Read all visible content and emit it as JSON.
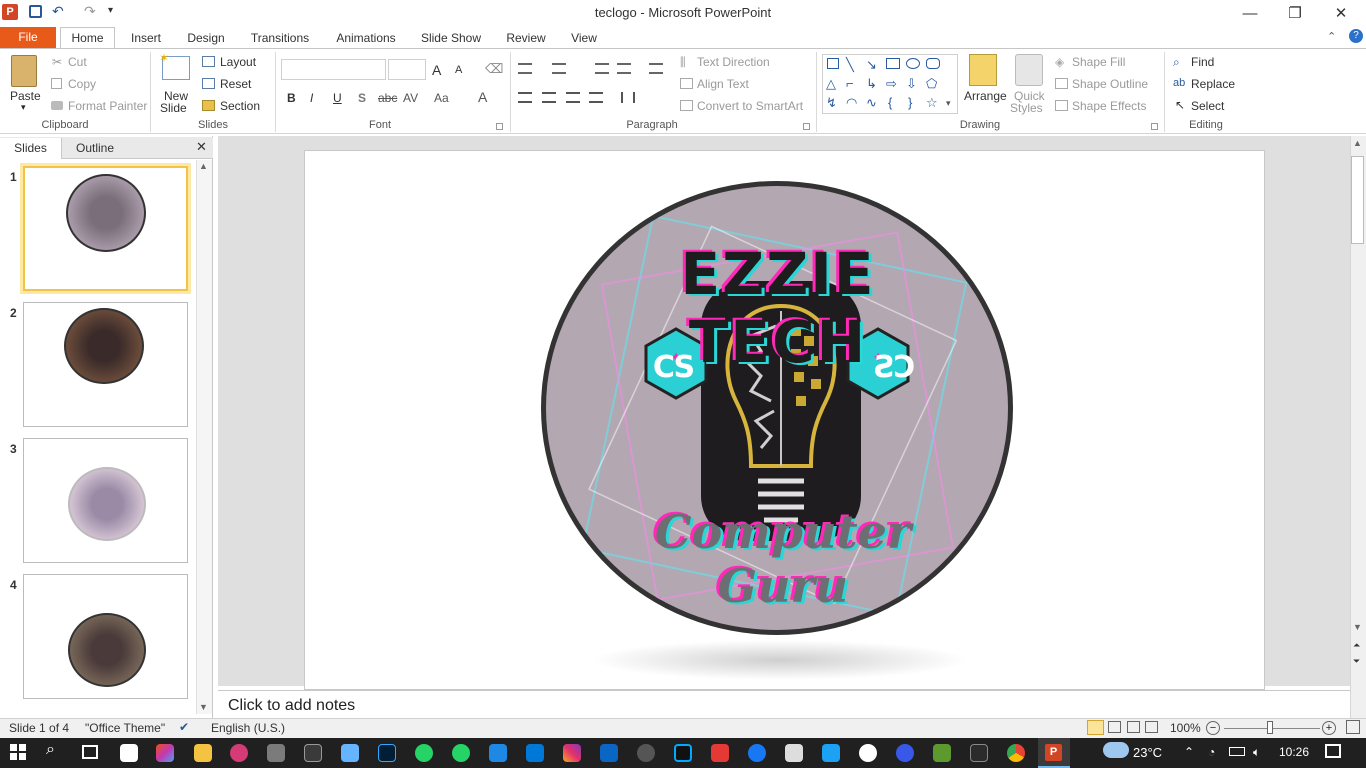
{
  "window": {
    "title": "teclogo  -  Microsoft PowerPoint"
  },
  "tabs": [
    "File",
    "Home",
    "Insert",
    "Design",
    "Transitions",
    "Animations",
    "Slide Show",
    "Review",
    "View"
  ],
  "ribbon": {
    "clipboard": {
      "label": "Clipboard",
      "paste": "Paste",
      "cut": "Cut",
      "copy": "Copy",
      "format_painter": "Format Painter"
    },
    "slides": {
      "label": "Slides",
      "new_slide": "New",
      "new_slide2": "Slide",
      "layout": "Layout",
      "reset": "Reset",
      "section": "Section"
    },
    "font": {
      "label": "Font",
      "bold": "B",
      "italic": "I",
      "underline": "U",
      "shadow": "S",
      "strike": "abc",
      "spacing": "AV",
      "case": "Aa",
      "color": "A",
      "grow": "A",
      "shrink": "A"
    },
    "paragraph": {
      "label": "Paragraph",
      "text_direction": "Text Direction",
      "align_text": "Align Text",
      "smartart": "Convert to SmartArt"
    },
    "drawing": {
      "label": "Drawing",
      "arrange": "Arrange",
      "quick": "Quick",
      "styles": "Styles",
      "shape_fill": "Shape Fill",
      "shape_outline": "Shape Outline",
      "shape_effects": "Shape Effects"
    },
    "editing": {
      "label": "Editing",
      "find": "Find",
      "replace": "Replace",
      "select": "Select"
    }
  },
  "panel": {
    "tabs": [
      "Slides",
      "Outline"
    ],
    "slides": [
      "1",
      "2",
      "3",
      "4"
    ]
  },
  "slide": {
    "logo_top": "EZZIE TECH",
    "logo_bottom": "Computer Guru",
    "badge_left": "CS",
    "badge_right": "CS"
  },
  "notes": {
    "placeholder": "Click to add notes"
  },
  "status": {
    "slide": "Slide 1 of 4",
    "theme": "\"Office Theme\"",
    "language": "English (U.S.)",
    "zoom": "100%"
  },
  "taskbar": {
    "weather": "23°C",
    "time": "10:26"
  },
  "colors": {
    "file_tab": "#e85a1a",
    "logo_bg": "#b3a7b2",
    "logo_text": "#ff29b8",
    "accent_teal": "#2ad6d6"
  }
}
